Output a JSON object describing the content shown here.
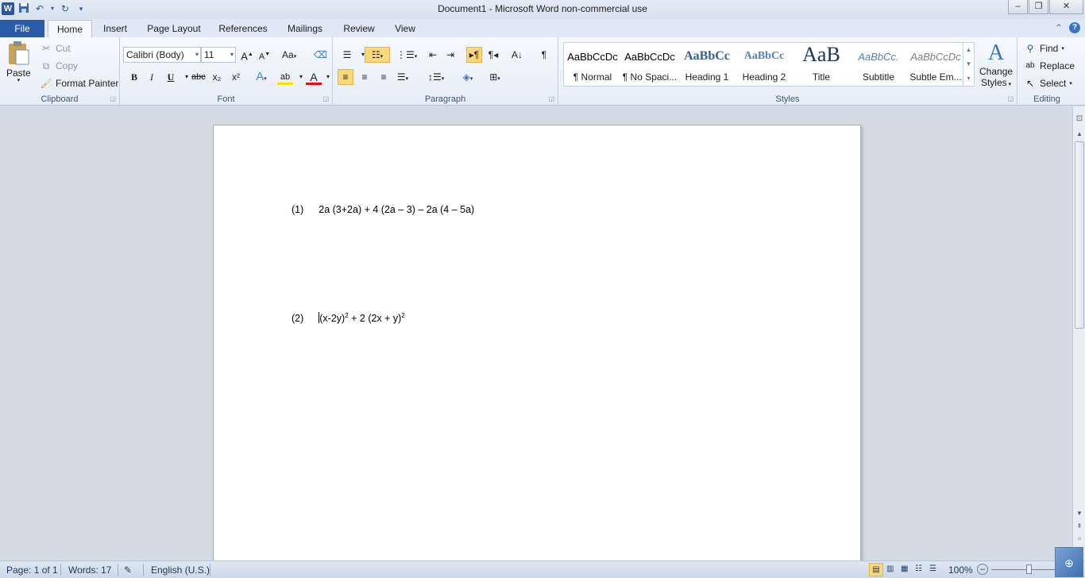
{
  "window": {
    "title": "Document1  -  Microsoft Word non-commercial use",
    "app_logo": "W",
    "controls": [
      "minimize-icon",
      "restore-icon",
      "close-icon"
    ]
  },
  "tabs": {
    "file": "File",
    "items": [
      "Home",
      "Insert",
      "Page Layout",
      "References",
      "Mailings",
      "Review",
      "View"
    ],
    "active": "Home"
  },
  "ribbon": {
    "clipboard": {
      "label": "Clipboard",
      "paste": "Paste",
      "cut": "Cut",
      "copy": "Copy",
      "format_painter": "Format Painter"
    },
    "font": {
      "label": "Font",
      "font_name": "Calibri (Body)",
      "font_size": "11",
      "grow": "A",
      "shrink": "A",
      "change_case": "Aa",
      "bold": "B",
      "italic": "I",
      "underline": "U",
      "strikethrough": "abc",
      "subscript": "x₂",
      "superscript": "x²",
      "text_effects": "A",
      "highlight": "ab",
      "font_color": "A"
    },
    "paragraph": {
      "label": "Paragraph",
      "show_marks": "¶"
    },
    "styles": {
      "label": "Styles",
      "items": [
        {
          "preview": "AaBbCcDc",
          "name": "¶ Normal"
        },
        {
          "preview": "AaBbCcDc",
          "name": "¶ No Spaci..."
        },
        {
          "preview": "AaBbCc",
          "name": "Heading 1"
        },
        {
          "preview": "AaBbCc",
          "name": "Heading 2"
        },
        {
          "preview": "AaB",
          "name": "Title"
        },
        {
          "preview": "AaBbCc.",
          "name": "Subtitle"
        },
        {
          "preview": "AaBbCcDc",
          "name": "Subtle Em..."
        }
      ],
      "change_styles_1": "Change",
      "change_styles_2": "Styles"
    },
    "editing": {
      "label": "Editing",
      "find": "Find",
      "replace": "Replace",
      "select": "Select"
    }
  },
  "document": {
    "line1": {
      "num": "(1)",
      "expr": "2a (3+2a) + 4  (2a – 3) – 2a  (4 – 5a)"
    },
    "line2": {
      "num": "(2)",
      "part_a": "(x-2y)",
      "exp_a": "2",
      "part_b": " + 2 (2x + y)",
      "exp_b": "2"
    }
  },
  "status": {
    "page": "Page: 1 of 1",
    "words": "Words: 17",
    "language": "English (U.S.)",
    "zoom": "100%"
  }
}
